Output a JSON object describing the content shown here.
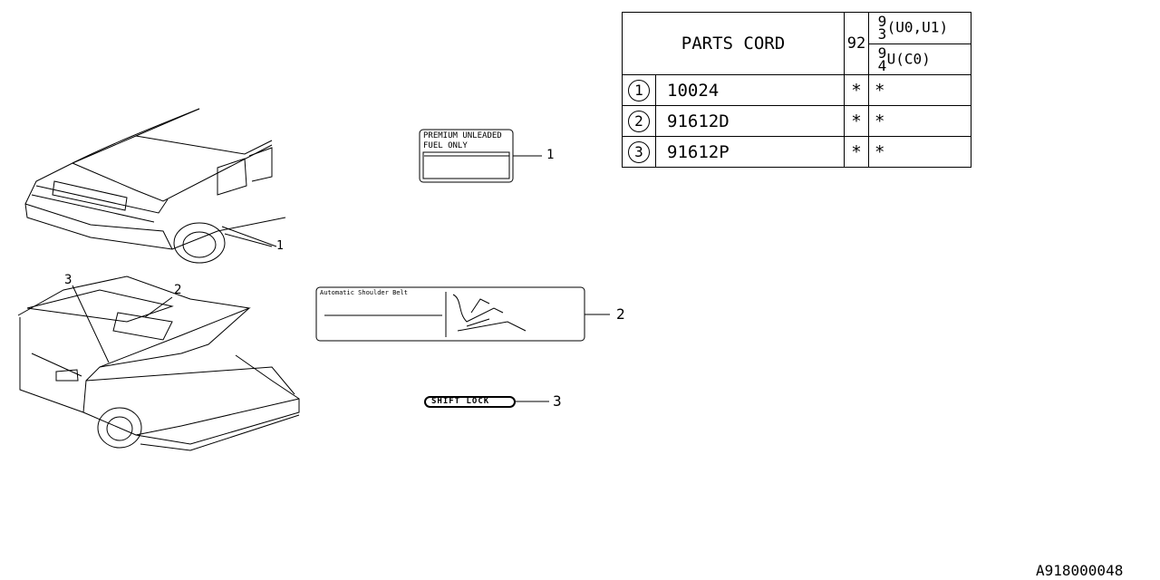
{
  "parts_table": {
    "header": "PARTS CORD",
    "model_year_col": "92",
    "sub_headers": [
      {
        "year": "93",
        "code": "(U0,U1)"
      },
      {
        "year": "94",
        "code": "U(C0)"
      }
    ],
    "rows": [
      {
        "ref": "1",
        "part": "10024",
        "col92": "*",
        "col93_94": "*"
      },
      {
        "ref": "2",
        "part": "91612D",
        "col92": "*",
        "col93_94": "*"
      },
      {
        "ref": "3",
        "part": "91612P",
        "col92": "*",
        "col93_94": "*"
      }
    ]
  },
  "labels": {
    "fuel_label": {
      "line1": "PREMIUM UNLEADED",
      "line2": "FUEL ONLY"
    },
    "belt_label": {
      "title": "Automatic Shoulder Belt"
    },
    "shift_lock": {
      "text": "SHIFT LOCK"
    }
  },
  "callouts": {
    "fuel": "1",
    "belt": "2",
    "shift": "3",
    "car_rear": "1",
    "car_front_2": "2",
    "car_front_3": "3"
  },
  "diagram_id": "A918000048"
}
